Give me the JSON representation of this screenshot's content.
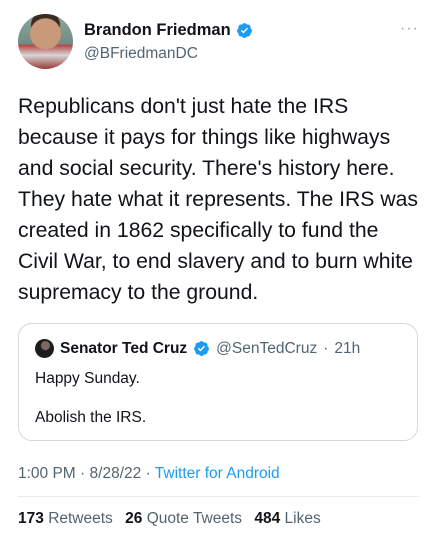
{
  "author": {
    "name": "Brandon Friedman",
    "handle": "@BFriedmanDC"
  },
  "more_label": "···",
  "tweet": {
    "text": "Republicans don't just hate the IRS because it pays for things like highways and social security. There's history here. They hate what it represents. The IRS was created in 1862 specifically to fund the Civil War, to end slavery and to burn white supremacy to the ground."
  },
  "quote": {
    "name": "Senator Ted Cruz",
    "handle": "@SenTedCruz",
    "separator": "·",
    "time": "21h",
    "line1": "Happy Sunday.",
    "line2": "Abolish the IRS."
  },
  "meta": {
    "time": "1:00 PM",
    "date": "8/28/22",
    "sep": "·",
    "source": "Twitter for Android"
  },
  "stats": {
    "retweets_count": "173",
    "retweets_label": "Retweets",
    "quotes_count": "26",
    "quotes_label": "Quote Tweets",
    "likes_count": "484",
    "likes_label": "Likes"
  },
  "colors": {
    "text": "#0f1419",
    "secondary": "#536471",
    "link": "#1d9bf0",
    "border": "#cfd9de"
  },
  "icons": {
    "verified": "verified-badge-icon",
    "more": "more-options-icon"
  }
}
